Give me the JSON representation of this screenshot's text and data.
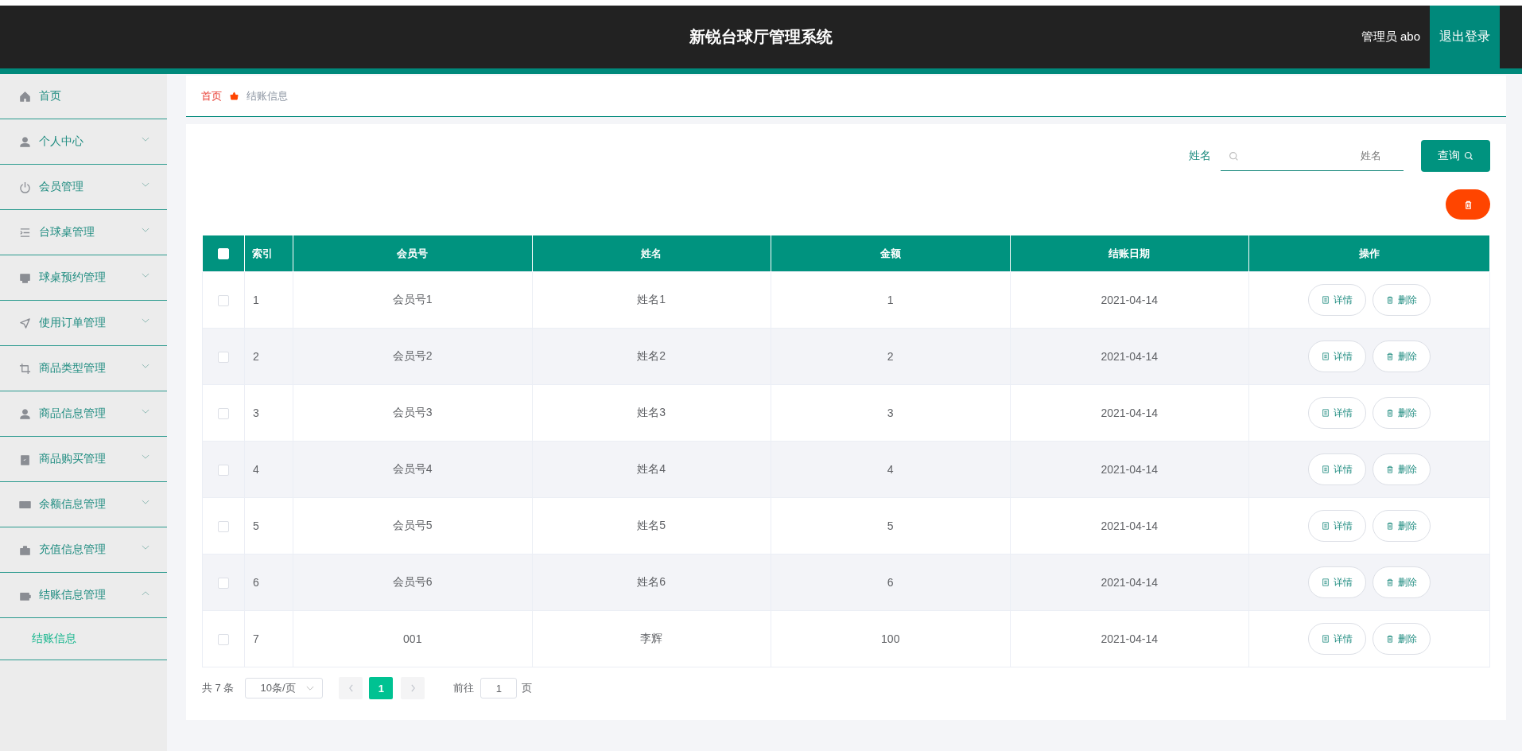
{
  "header": {
    "title": "新锐台球厅管理系统",
    "user": "管理员 abo",
    "logout": "退出登录"
  },
  "sidebar": {
    "items": [
      {
        "label": "首页"
      },
      {
        "label": "个人中心",
        "expanded": false
      },
      {
        "label": "会员管理",
        "expanded": false
      },
      {
        "label": "台球桌管理",
        "expanded": false
      },
      {
        "label": "球桌预约管理",
        "expanded": false
      },
      {
        "label": "使用订单管理",
        "expanded": false
      },
      {
        "label": "商品类型管理",
        "expanded": false
      },
      {
        "label": "商品信息管理",
        "expanded": false
      },
      {
        "label": "商品购买管理",
        "expanded": false
      },
      {
        "label": "余额信息管理",
        "expanded": false
      },
      {
        "label": "充值信息管理",
        "expanded": false
      },
      {
        "label": "结账信息管理",
        "expanded": true,
        "children": [
          {
            "label": "结账信息",
            "selected": true
          }
        ]
      }
    ]
  },
  "breadcrumb": [
    "首页",
    "结账信息"
  ],
  "search": {
    "label": "姓名",
    "placeholder": "姓名",
    "button": "查询"
  },
  "table": {
    "select_all_checked": false,
    "columns": [
      "索引",
      "会员号",
      "姓名",
      "金额",
      "结账日期",
      "操作"
    ],
    "rows": [
      {
        "checked": false,
        "cells": [
          "1",
          "会员号1",
          "姓名1",
          "1",
          "2021-04-14"
        ],
        "actions": [
          "详情",
          "删除"
        ]
      },
      {
        "checked": false,
        "cells": [
          "2",
          "会员号2",
          "姓名2",
          "2",
          "2021-04-14"
        ],
        "actions": [
          "详情",
          "删除"
        ]
      },
      {
        "checked": false,
        "cells": [
          "3",
          "会员号3",
          "姓名3",
          "3",
          "2021-04-14"
        ],
        "actions": [
          "详情",
          "删除"
        ]
      },
      {
        "checked": false,
        "cells": [
          "4",
          "会员号4",
          "姓名4",
          "4",
          "2021-04-14"
        ],
        "actions": [
          "详情",
          "删除"
        ]
      },
      {
        "checked": false,
        "cells": [
          "5",
          "会员号5",
          "姓名5",
          "5",
          "2021-04-14"
        ],
        "actions": [
          "详情",
          "删除"
        ]
      },
      {
        "checked": false,
        "cells": [
          "6",
          "会员号6",
          "姓名6",
          "6",
          "2021-04-14"
        ],
        "actions": [
          "详情",
          "删除"
        ]
      },
      {
        "checked": false,
        "cells": [
          "7",
          "001",
          "李辉",
          "100",
          "2021-04-14"
        ],
        "actions": [
          "详情",
          "删除"
        ]
      }
    ]
  },
  "pagination": {
    "total": "共 7 条",
    "page_size": "10条/页",
    "pages": [
      {
        "label": "1",
        "selected": true
      }
    ],
    "goto_label": "前往",
    "goto_value": "1",
    "goto_suffix": "页"
  }
}
